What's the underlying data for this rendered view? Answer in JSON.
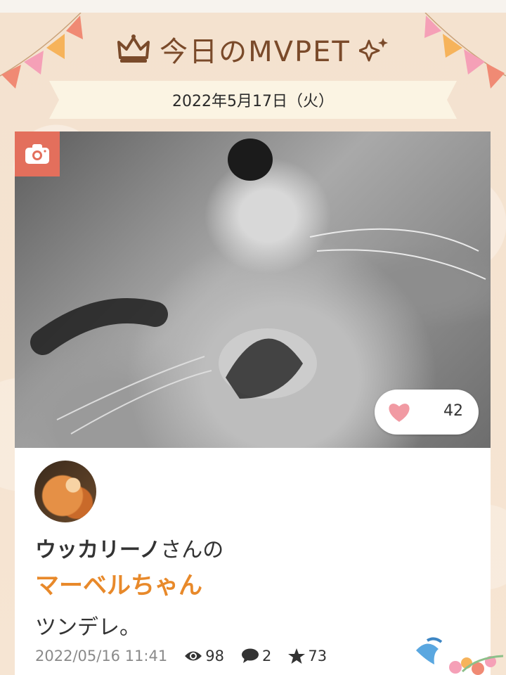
{
  "header": {
    "title": "今日のMVPET",
    "date": "2022年5月17日（火）"
  },
  "post": {
    "likes": "42",
    "owner_name": "ウッカリーノ",
    "owner_suffix": "さんの",
    "pet_name": "マーベルちゃん",
    "caption": "ツンデレ。",
    "timestamp": "2022/05/16  11:41",
    "views": "98",
    "comments": "2",
    "favorites": "73"
  },
  "icons": {
    "crown": "crown-icon",
    "sparkle": "sparkle-icon",
    "camera": "camera-icon",
    "heart": "heart-icon",
    "eye": "eye-icon",
    "comment": "comment-icon",
    "star": "star-icon"
  },
  "colors": {
    "accent": "#e8892a",
    "camera_badge": "#e36f5c",
    "heart": "#f19aa3",
    "title": "#7a4a2a"
  }
}
